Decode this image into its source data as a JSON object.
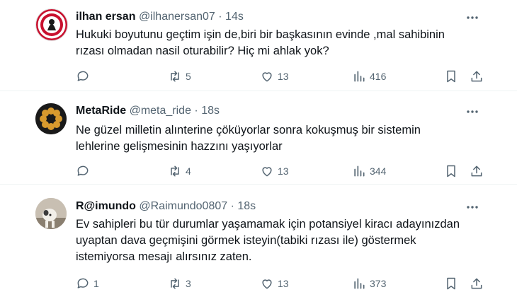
{
  "colors": {
    "text": "#0f1419",
    "muted": "#536471",
    "divider": "#eff3f4"
  },
  "tweets": [
    {
      "name": "ilhan ersan",
      "handle": "@ilhanersan07",
      "dot": "·",
      "time": "14s",
      "avatar": "political-emblem-avatar",
      "lines": [
        "Hukuki boyutunu geçtim işin de,biri bir başkasının evinde ,mal sahibinin",
        "rızası olmadan nasil oturabilir? Hiç mi ahlak yok?"
      ],
      "replies": "",
      "retweets": "5",
      "likes": "13",
      "views": "416"
    },
    {
      "name": "MetaRide",
      "handle": "@meta_ride",
      "dot": "·",
      "time": "18s",
      "avatar": "flower-avatar",
      "lines": [
        "Ne güzel milletin alınterine çöküyorlar sonra kokuşmuş bir sistemin",
        "lehlerine gelişmesinin hazzını yaşıyorlar"
      ],
      "replies": "",
      "retweets": "4",
      "likes": "13",
      "views": "344"
    },
    {
      "name": "R@imundo",
      "handle": "@Raimundo0807",
      "dot": "·",
      "time": "18s",
      "avatar": "photo-avatar",
      "lines": [
        "Ev sahipleri bu tür durumlar yaşamamak için potansiyel kiracı adayınızdan",
        "uyaptan dava geçmişini görmek isteyin(tabiki rızası ile) göstermek",
        "istemiyorsa mesajı alırsınız zaten."
      ],
      "replies": "1",
      "retweets": "3",
      "likes": "13",
      "views": "373"
    }
  ]
}
